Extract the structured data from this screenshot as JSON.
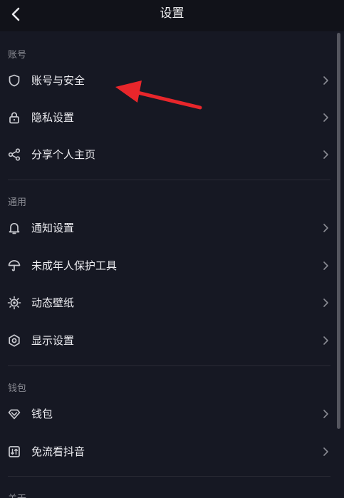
{
  "header": {
    "title": "设置",
    "back_icon": "chevron-left-icon"
  },
  "sections": [
    {
      "title": "账号",
      "items": [
        {
          "label": "账号与安全",
          "icon": "shield-icon"
        },
        {
          "label": "隐私设置",
          "icon": "lock-icon"
        },
        {
          "label": "分享个人主页",
          "icon": "share-icon"
        }
      ]
    },
    {
      "title": "通用",
      "items": [
        {
          "label": "通知设置",
          "icon": "bell-icon"
        },
        {
          "label": "未成年人保护工具",
          "icon": "umbrella-icon"
        },
        {
          "label": "动态壁纸",
          "icon": "wallpaper-icon"
        },
        {
          "label": "显示设置",
          "icon": "display-icon"
        }
      ]
    },
    {
      "title": "钱包",
      "items": [
        {
          "label": "钱包",
          "icon": "diamond-icon"
        },
        {
          "label": "免流看抖音",
          "icon": "data-saver-icon"
        }
      ]
    },
    {
      "title": "关于",
      "items": []
    }
  ],
  "colors": {
    "background": "#161823",
    "topbar": "#111219",
    "annotation_arrow": "#e8262b"
  }
}
